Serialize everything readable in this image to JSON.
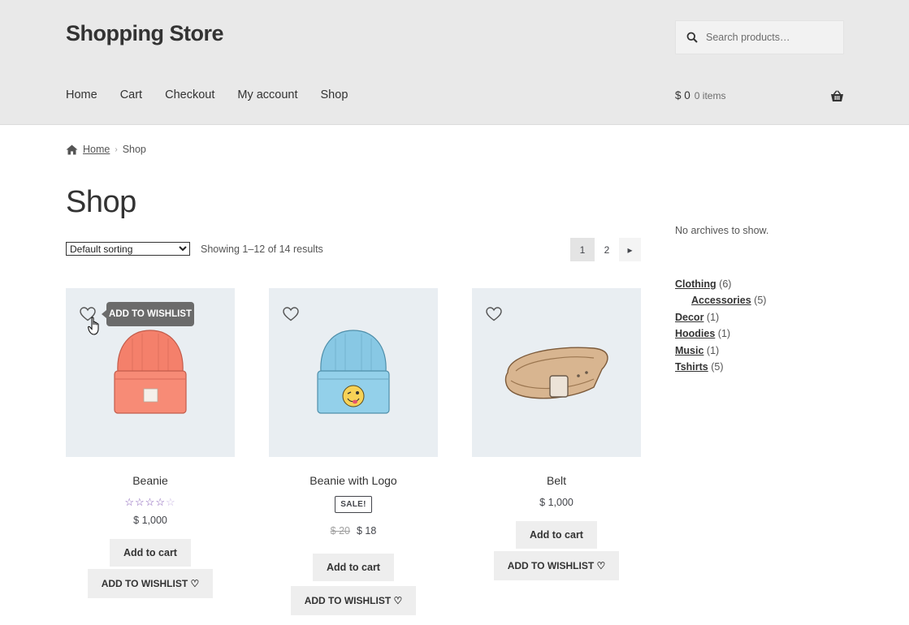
{
  "site": {
    "title": "Shopping Store"
  },
  "search": {
    "placeholder": "Search products…"
  },
  "nav": {
    "items": [
      "Home",
      "Cart",
      "Checkout",
      "My account",
      "Shop"
    ]
  },
  "cart": {
    "amount": "$ 0",
    "items": "0 items"
  },
  "breadcrumb": {
    "home": "Home",
    "sep": "›",
    "current": "Shop"
  },
  "page": {
    "title": "Shop"
  },
  "sorting": {
    "selected": "Default sorting"
  },
  "results": {
    "count": "Showing 1–12 of 14 results"
  },
  "pagination": {
    "pages": [
      "1",
      "2"
    ],
    "current": "1",
    "next": "▸"
  },
  "tooltip": {
    "label": "ADD TO WISHLIST"
  },
  "products": [
    {
      "name": "Beanie",
      "rating": 3.5,
      "price": "$ 1,000",
      "cart_label": "Add to cart",
      "wish_label": "ADD TO WISHLIST ♡"
    },
    {
      "name": "Beanie with Logo",
      "sale_badge": "SALE!",
      "old_price": "$ 20",
      "price": "$ 18",
      "cart_label": "Add to cart",
      "wish_label": "ADD TO WISHLIST ♡"
    },
    {
      "name": "Belt",
      "price": "$ 1,000",
      "cart_label": "Add to cart",
      "wish_label": "ADD TO WISHLIST ♡"
    }
  ],
  "sidebar": {
    "archives": "No archives to show.",
    "categories": [
      {
        "name": "Clothing",
        "count": "(6)"
      },
      {
        "name": "Accessories",
        "count": "(5)"
      },
      {
        "name": "Decor",
        "count": "(1)"
      },
      {
        "name": "Hoodies",
        "count": "(1)"
      },
      {
        "name": "Music",
        "count": "(1)"
      },
      {
        "name": "Tshirts",
        "count": "(5)"
      }
    ]
  },
  "colors": {
    "header_bg": "#e9e9e9",
    "accent": "#7f54b3",
    "button_bg": "#eeeeee",
    "product_bg": "#e9eef2"
  }
}
